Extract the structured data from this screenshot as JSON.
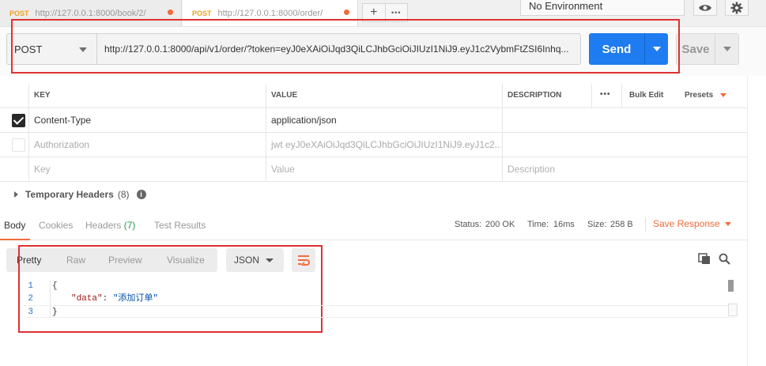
{
  "tabs": [
    {
      "method": "POST",
      "url": "http://127.0.0.1:8000/book/2/",
      "active": false
    },
    {
      "method": "POST",
      "url": "http://127.0.0.1:8000/order/",
      "active": true
    }
  ],
  "tab_add_symbol": "+",
  "tab_more_symbol": "•••",
  "environment": "No Environment",
  "request": {
    "method": "POST",
    "url": "http://127.0.0.1:8000/api/v1/order/?token=eyJ0eXAiOiJqd3QiLCJhbGciOiJIUzI1NiJ9.eyJ1c2VybmFtZSI6Inhq...",
    "send_label": "Send",
    "save_label": "Save"
  },
  "headers_table": {
    "columns": [
      "KEY",
      "VALUE",
      "DESCRIPTION"
    ],
    "more_label": "•••",
    "bulk_edit_label": "Bulk Edit",
    "presets_label": "Presets",
    "rows": [
      {
        "checked": true,
        "key": "Content-Type",
        "value": "application/json",
        "description": ""
      },
      {
        "checked": false,
        "key": "Authorization",
        "value": "jwt eyJ0eXAiOiJqd3QiLCJhbGciOiJIUzI1NiJ9.eyJ1c2...",
        "description": ""
      }
    ],
    "placeholder": {
      "key": "Key",
      "value": "Value",
      "description": "Description"
    }
  },
  "temporary_headers": {
    "label": "Temporary Headers",
    "count": "(8)"
  },
  "response": {
    "tabs": {
      "body": "Body",
      "cookies": "Cookies",
      "headers": "Headers",
      "headers_count": "(7)",
      "test_results": "Test Results"
    },
    "status_label": "Status:",
    "status_value": "200 OK",
    "time_label": "Time:",
    "time_value": "16ms",
    "size_label": "Size:",
    "size_value": "258 B",
    "save_response_label": "Save Response",
    "format_modes": [
      "Pretty",
      "Raw",
      "Preview",
      "Visualize"
    ],
    "active_mode": "Pretty",
    "language": "JSON",
    "code_lines": [
      {
        "num": "1",
        "text": "{"
      },
      {
        "num": "2",
        "key": "\"data\"",
        "value": "\"添加订单\""
      },
      {
        "num": "3",
        "text": "}"
      }
    ]
  },
  "colors": {
    "accent": "#f26b3a",
    "send": "#1f7cf0",
    "highlight": "#e03131",
    "status_ok": "#1f9c4b"
  }
}
